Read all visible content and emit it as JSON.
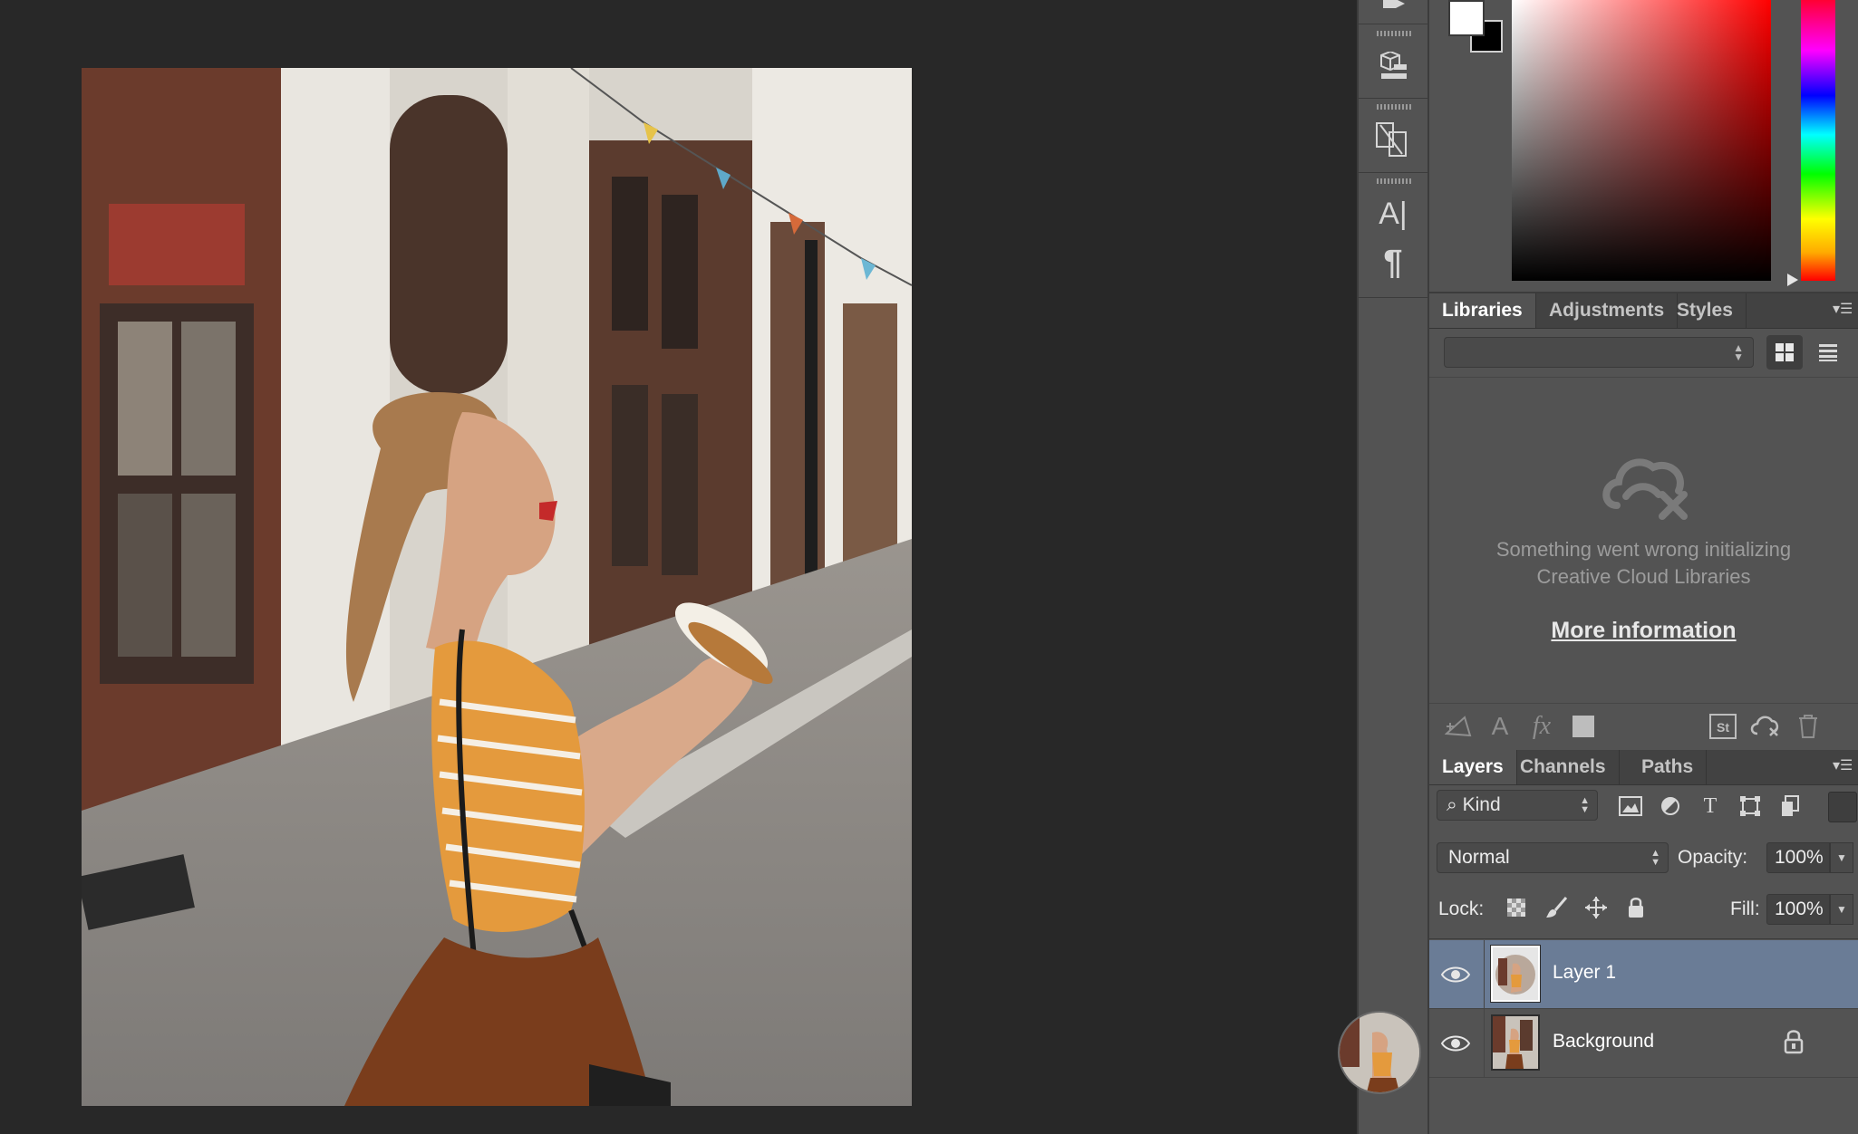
{
  "tool_strip": {
    "icons": [
      "history-brush-panel-icon",
      "3d-panel-icon",
      "glyphs-panel-icon",
      "character-panel-icon",
      "paragraph-panel-icon"
    ],
    "character_glyph": "A|",
    "paragraph_glyph": "¶"
  },
  "color_panel": {
    "foreground_color": "#ffffff",
    "background_color": "#000000",
    "hue": "#ff0000"
  },
  "libraries_panel": {
    "tabs": [
      {
        "label": "Libraries",
        "active": true
      },
      {
        "label": "Adjustments",
        "active": false
      },
      {
        "label": "Styles",
        "active": false
      }
    ],
    "library_select_value": "",
    "error_line1": "Something went wrong initializing",
    "error_line2": "Creative Cloud Libraries",
    "more_info_link": "More information",
    "footer_icons": [
      "add-graphic-icon",
      "add-character-style-icon",
      "add-layer-style-icon",
      "add-fill-color-icon",
      "adobe-stock-icon",
      "cc-sync-icon",
      "trash-icon"
    ],
    "footer_labels": {
      "char_style": "A",
      "layer_style": "fx",
      "stock": "St"
    }
  },
  "layers_panel": {
    "tabs": [
      {
        "label": "Layers",
        "active": true
      },
      {
        "label": "Channels",
        "active": false
      },
      {
        "label": "Paths",
        "active": false
      }
    ],
    "filter_kind": "Kind",
    "filter_type_glyph": "T",
    "blend_mode": "Normal",
    "opacity_label": "Opacity:",
    "opacity_value": "100%",
    "lock_label": "Lock:",
    "fill_label": "Fill:",
    "fill_value": "100%",
    "layers": [
      {
        "name": "Layer 1",
        "visible": true,
        "selected": true,
        "locked": false
      },
      {
        "name": "Background",
        "visible": true,
        "selected": false,
        "locked": true
      }
    ]
  }
}
